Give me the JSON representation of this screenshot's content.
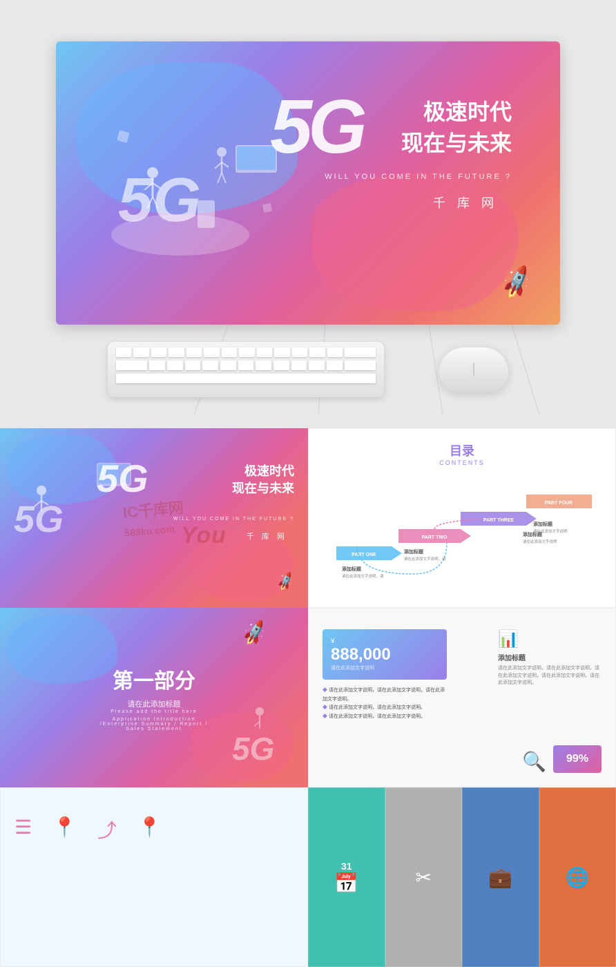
{
  "hero": {
    "5g_left": "5G",
    "5g_big": "5G",
    "title_cn_line1": "极速时代",
    "title_cn_line2": "现在与未来",
    "subtitle_en": "WILL YOU COME IN THE FUTURE ?",
    "brand": "千 库 网"
  },
  "watermark": {
    "ic": "IC千库网",
    "site": "588ku.com",
    "you": "You"
  },
  "contents": {
    "title_cn": "目录",
    "title_en": "CONTENTS",
    "parts": [
      {
        "label": "PART ONE",
        "title": "添加标题",
        "desc": "请在此添加文字说明，请在此添加文字说明。"
      },
      {
        "label": "PART TWO",
        "title": "添加标题",
        "desc": "请在此添加文字说明，请在此添加文字说明。"
      },
      {
        "label": "PART THREE",
        "title": "添加标题",
        "desc": "请在此添加文字说明，请在此添加文字说明。"
      },
      {
        "label": "PART FOUR",
        "title": "添加标题",
        "desc": "请在此添加文字说明，请在此添加文字说明。"
      }
    ]
  },
  "part1": {
    "main": "第一部分",
    "sub": "请在此添加标题",
    "en1": "Please add the title here",
    "en2": "Application Introduction /Enterprise Summary / Report / Sales Statement"
  },
  "data_slide": {
    "yuan_amount": "888,000",
    "yuan_label": "请在此添加文字说明",
    "bullets": [
      "请在此添加文字说明，请在此添加文字说明，请在此添加文字说明。",
      "请在此添加文字说明，请在此添加文字说明。",
      "请在此添加文字说明，请在此添加文字说明。"
    ],
    "add_title": "添加标题",
    "add_desc": "请在此添加文字说明，请在此添加文字说明，请在此添加文字说明，请在此添加文字说明，请在此添加文字说明。",
    "percent": "99%"
  },
  "bottom_right": {
    "date": "31",
    "cells": [
      "calendar",
      "scissors-tool",
      "briefcase",
      "globe"
    ]
  }
}
